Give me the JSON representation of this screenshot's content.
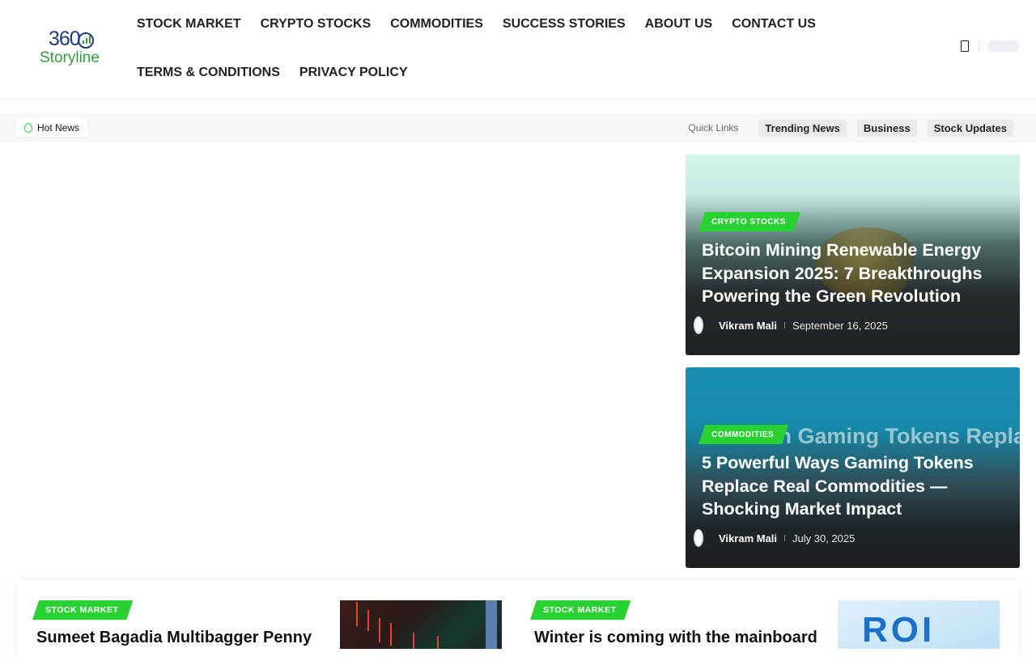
{
  "logo": {
    "line1": "360",
    "line2": "Storyline"
  },
  "nav": {
    "row1": [
      "STOCK MARKET",
      "CRYPTO STOCKS",
      "COMMODITIES",
      "SUCCESS STORIES",
      "ABOUT US",
      "CONTACT US"
    ],
    "row2": [
      "TERMS & CONDITIONS",
      "PRIVACY POLICY"
    ]
  },
  "hotbar": {
    "badge": "Hot News",
    "quick_label": "Quick Links",
    "quick_links": [
      "Trending News",
      "Business",
      "Stock Updates"
    ]
  },
  "cards": [
    {
      "category": "CRYPTO STOCKS",
      "title": "Bitcoin Mining Renewable Energy Expansion 2025: 7 Breakthroughs Powering the Green Revolution",
      "author": "Vikram Mali",
      "date": "September 16, 2025"
    },
    {
      "category": "COMMODITIES",
      "ghost": "Can Gaming Tokens Replace",
      "title": "5 Powerful Ways Gaming Tokens Replace Real Commodities — Shocking Market Impact",
      "author": "Vikram Mali",
      "date": "July 30, 2025"
    }
  ],
  "bottom_posts": [
    {
      "category": "STOCK MARKET",
      "title": "Sumeet Bagadia Multibagger Penny"
    },
    {
      "category": "STOCK MARKET",
      "title": "Winter is coming with the mainboard"
    }
  ],
  "colors": {
    "accent": "#29d132",
    "text": "#111111",
    "hotbar_bg": "#f7f7f7"
  }
}
